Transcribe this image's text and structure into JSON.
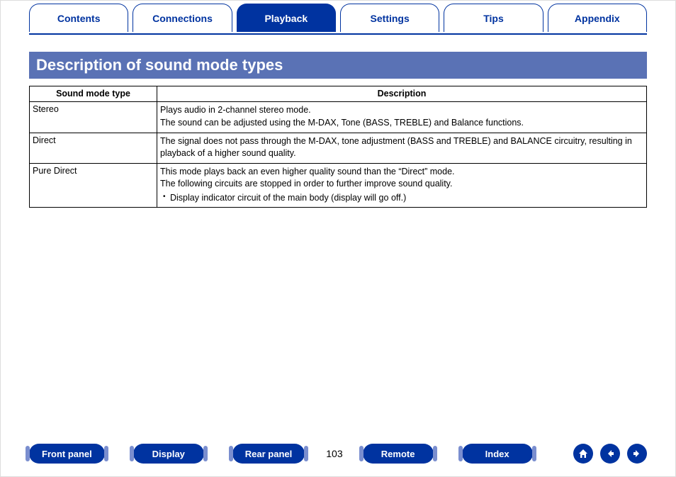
{
  "tabs": {
    "items": [
      {
        "label": "Contents",
        "active": false
      },
      {
        "label": "Connections",
        "active": false
      },
      {
        "label": "Playback",
        "active": true
      },
      {
        "label": "Settings",
        "active": false
      },
      {
        "label": "Tips",
        "active": false
      },
      {
        "label": "Appendix",
        "active": false
      }
    ]
  },
  "section": {
    "title": "Description of sound mode types"
  },
  "table": {
    "headers": {
      "type": "Sound mode type",
      "desc": "Description"
    },
    "rows": [
      {
        "type": "Stereo",
        "lines": [
          "Plays audio in 2-channel stereo mode.",
          "The sound can be adjusted using the M-DAX, Tone (BASS, TREBLE) and Balance functions."
        ],
        "bullets": []
      },
      {
        "type": "Direct",
        "lines": [
          "The signal does not pass through the M-DAX, tone adjustment (BASS and TREBLE) and BALANCE circuitry, resulting in playback of a higher sound quality."
        ],
        "bullets": []
      },
      {
        "type": "Pure Direct",
        "lines": [
          "This mode plays back an even higher quality sound than the “Direct” mode.",
          "The following circuits are stopped in order to further improve sound quality."
        ],
        "bullets": [
          "Display indicator circuit of the main body (display will go off.)"
        ]
      }
    ]
  },
  "footer": {
    "links": [
      {
        "label": "Front panel"
      },
      {
        "label": "Display"
      },
      {
        "label": "Rear panel"
      }
    ],
    "page": "103",
    "links2": [
      {
        "label": "Remote"
      },
      {
        "label": "Index"
      }
    ]
  },
  "colors": {
    "accent": "#0033a0",
    "header_bg": "#5a72b5"
  }
}
